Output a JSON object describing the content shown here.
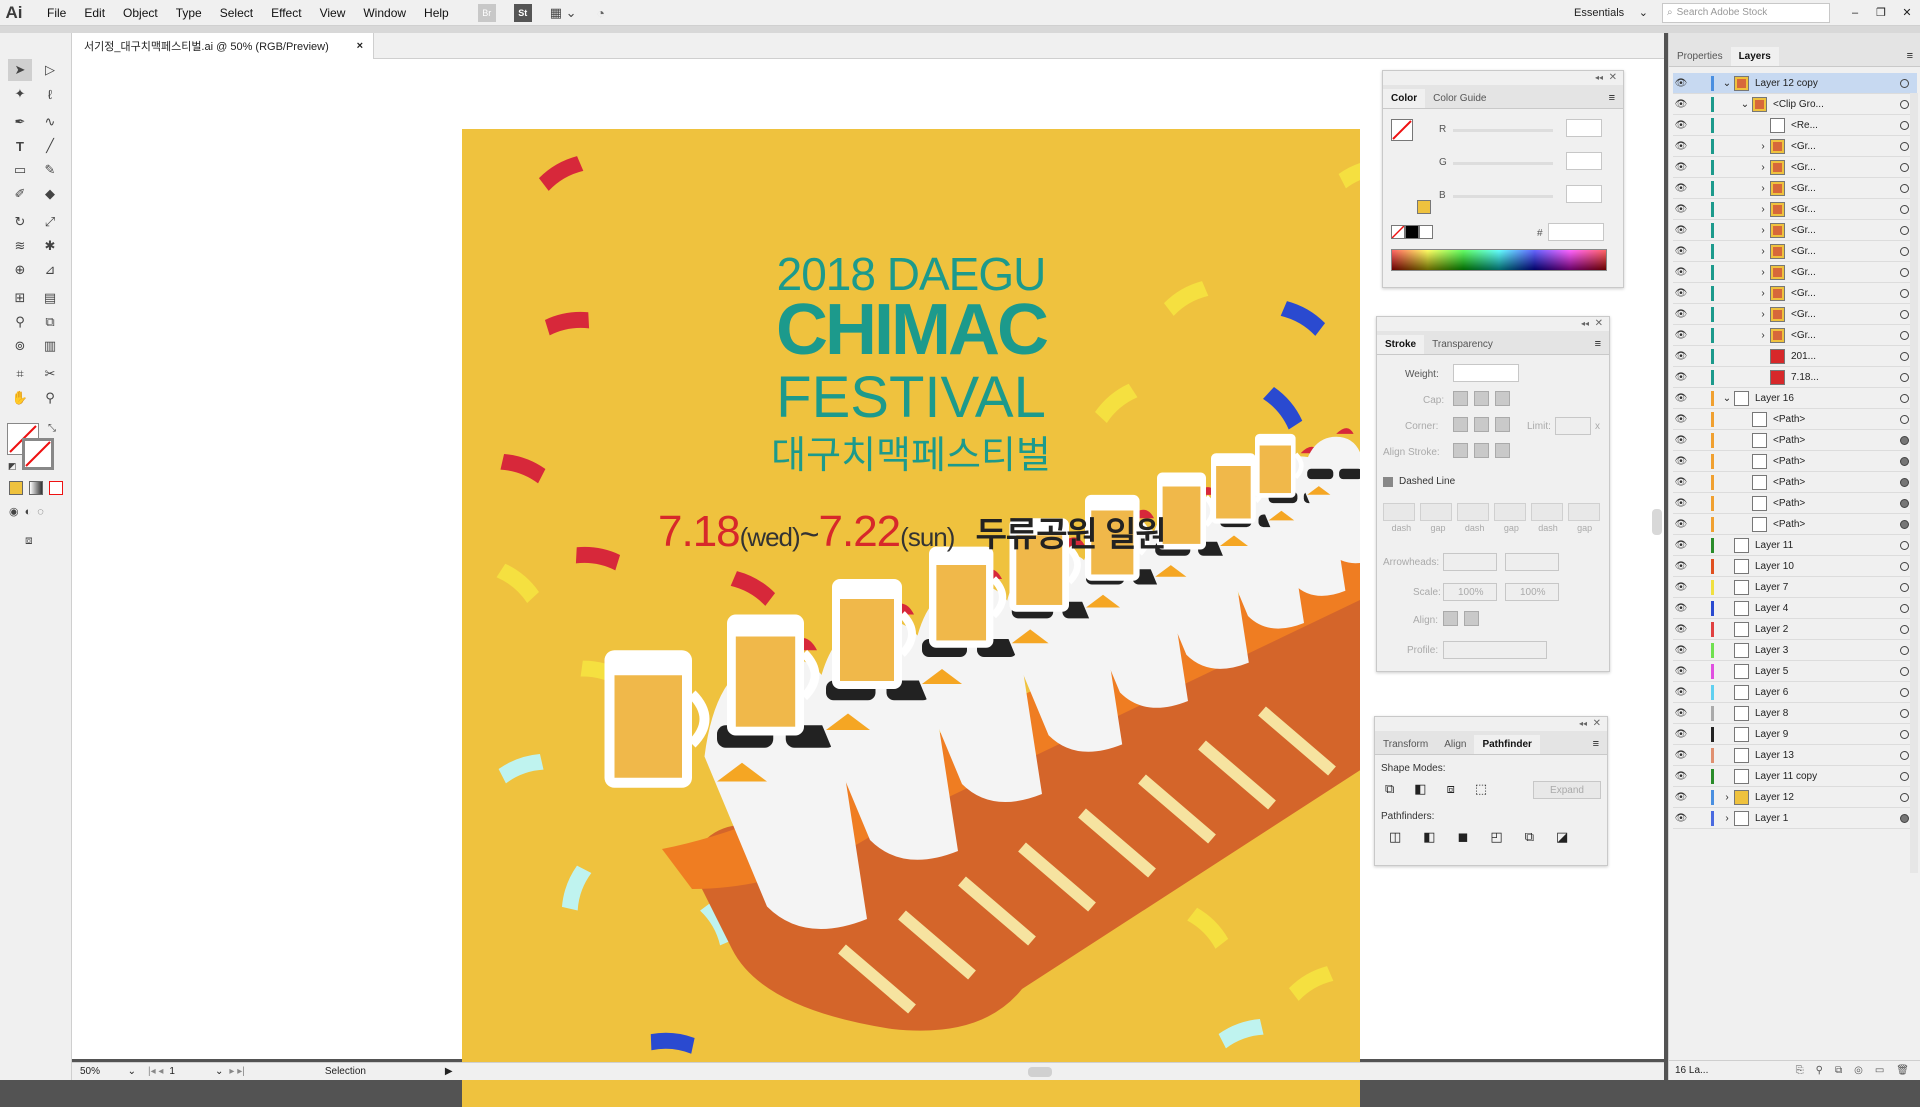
{
  "menubar": {
    "logo": "Ai",
    "items": [
      "File",
      "Edit",
      "Object",
      "Type",
      "Select",
      "Effect",
      "View",
      "Window",
      "Help"
    ],
    "bridge": "Br",
    "stock": "St",
    "workspace": "Essentials",
    "search_placeholder": "Search Adobe Stock"
  },
  "document": {
    "tab_title": "서기정_대구치맥페스티벌.ai @ 50% (RGB/Preview)",
    "close": "×"
  },
  "artwork": {
    "line1": "2018 DAEGU",
    "line2": "CHIMAC",
    "line3": "FESTIVAL",
    "line4": "대구치맥페스티벌",
    "date_start": "7.18",
    "day_start": "(wed)",
    "tilde": "~",
    "date_end": "7.22",
    "day_end": "(sun)",
    "venue": "두류공원 일원",
    "colors": {
      "background": "#efc23e",
      "teal": "#1c9a8c",
      "red": "#d7282a"
    }
  },
  "color_panel": {
    "tabs": [
      "Color",
      "Color Guide"
    ],
    "r": "R",
    "g": "G",
    "b": "B",
    "hash": "#"
  },
  "stroke_panel": {
    "tabs": [
      "Stroke",
      "Transparency"
    ],
    "weight": "Weight:",
    "cap": "Cap:",
    "corner": "Corner:",
    "limit": "Limit:",
    "limit_unit": "x",
    "align_stroke": "Align Stroke:",
    "dashed_line": "Dashed Line",
    "dash_labels": [
      "dash",
      "gap",
      "dash",
      "gap",
      "dash",
      "gap"
    ],
    "arrowheads": "Arrowheads:",
    "scale": "Scale:",
    "scale_a": "100%",
    "scale_b": "100%",
    "align": "Align:",
    "profile": "Profile:"
  },
  "pathfinder_panel": {
    "tabs": [
      "Transform",
      "Align",
      "Pathfinder"
    ],
    "shape_modes": "Shape Modes:",
    "expand": "Expand",
    "pathfinders": "Pathfinders:"
  },
  "layers_panel": {
    "tabs": [
      "Properties",
      "Layers"
    ],
    "footer": "16 La...",
    "rows": [
      {
        "name": "Layer 12 copy",
        "indent": 0,
        "arrow": "⌄",
        "color": "#4a8fe0",
        "sel": true,
        "dot": false
      },
      {
        "name": "<Clip Gro...",
        "indent": 1,
        "arrow": "⌄",
        "color": "#1c9a8c",
        "dot": false
      },
      {
        "name": "<Re...",
        "indent": 2,
        "arrow": "",
        "color": "#1c9a8c",
        "dot": false
      },
      {
        "name": "<Gr...",
        "indent": 2,
        "arrow": "›",
        "color": "#1c9a8c",
        "dot": false
      },
      {
        "name": "<Gr...",
        "indent": 2,
        "arrow": "›",
        "color": "#1c9a8c",
        "dot": false
      },
      {
        "name": "<Gr...",
        "indent": 2,
        "arrow": "›",
        "color": "#1c9a8c",
        "dot": false
      },
      {
        "name": "<Gr...",
        "indent": 2,
        "arrow": "›",
        "color": "#1c9a8c",
        "dot": false
      },
      {
        "name": "<Gr...",
        "indent": 2,
        "arrow": "›",
        "color": "#1c9a8c",
        "dot": false
      },
      {
        "name": "<Gr...",
        "indent": 2,
        "arrow": "›",
        "color": "#1c9a8c",
        "dot": false
      },
      {
        "name": "<Gr...",
        "indent": 2,
        "arrow": "›",
        "color": "#1c9a8c",
        "dot": false
      },
      {
        "name": "<Gr...",
        "indent": 2,
        "arrow": "›",
        "color": "#1c9a8c",
        "dot": false
      },
      {
        "name": "<Gr...",
        "indent": 2,
        "arrow": "›",
        "color": "#1c9a8c",
        "dot": false
      },
      {
        "name": "<Gr...",
        "indent": 2,
        "arrow": "›",
        "color": "#1c9a8c",
        "dot": false
      },
      {
        "name": "201...",
        "indent": 2,
        "arrow": "",
        "color": "#1c9a8c",
        "dot": false
      },
      {
        "name": "7.18...",
        "indent": 2,
        "arrow": "",
        "color": "#1c9a8c",
        "dot": false
      },
      {
        "name": "Layer 16",
        "indent": 0,
        "arrow": "⌄",
        "color": "#f0a030",
        "dot": false
      },
      {
        "name": "<Path>",
        "indent": 1,
        "arrow": "",
        "color": "#f0a030",
        "dot": false
      },
      {
        "name": "<Path>",
        "indent": 1,
        "arrow": "",
        "color": "#f0a030",
        "dot": true
      },
      {
        "name": "<Path>",
        "indent": 1,
        "arrow": "",
        "color": "#f0a030",
        "dot": true
      },
      {
        "name": "<Path>",
        "indent": 1,
        "arrow": "",
        "color": "#f0a030",
        "dot": true
      },
      {
        "name": "<Path>",
        "indent": 1,
        "arrow": "",
        "color": "#f0a030",
        "dot": true
      },
      {
        "name": "<Path>",
        "indent": 1,
        "arrow": "",
        "color": "#f0a030",
        "dot": true
      },
      {
        "name": "Layer 11",
        "indent": 0,
        "arrow": "",
        "color": "#2a8c2a",
        "dot": false
      },
      {
        "name": "Layer 10",
        "indent": 0,
        "arrow": "",
        "color": "#e05020",
        "dot": false
      },
      {
        "name": "Layer 7",
        "indent": 0,
        "arrow": "",
        "color": "#f0e040",
        "dot": false
      },
      {
        "name": "Layer 4",
        "indent": 0,
        "arrow": "",
        "color": "#2a4ad0",
        "dot": false
      },
      {
        "name": "Layer 2",
        "indent": 0,
        "arrow": "",
        "color": "#e04040",
        "dot": false
      },
      {
        "name": "Layer 3",
        "indent": 0,
        "arrow": "",
        "color": "#70e050",
        "dot": false
      },
      {
        "name": "Layer 5",
        "indent": 0,
        "arrow": "",
        "color": "#e050e0",
        "dot": false
      },
      {
        "name": "Layer 6",
        "indent": 0,
        "arrow": "",
        "color": "#60d0f0",
        "dot": false
      },
      {
        "name": "Layer 8",
        "indent": 0,
        "arrow": "",
        "color": "#aaaaaa",
        "dot": false
      },
      {
        "name": "Layer 9",
        "indent": 0,
        "arrow": "",
        "color": "#222222",
        "dot": false
      },
      {
        "name": "Layer 13",
        "indent": 0,
        "arrow": "",
        "color": "#e09070",
        "dot": false
      },
      {
        "name": "Layer 11 copy",
        "indent": 0,
        "arrow": "",
        "color": "#2a8c2a",
        "dot": false
      },
      {
        "name": "Layer 12",
        "indent": 0,
        "arrow": "›",
        "color": "#4a8fe0",
        "dot": false
      },
      {
        "name": "Layer 1",
        "indent": 0,
        "arrow": "›",
        "color": "#4a6ae0",
        "dot": true
      }
    ]
  },
  "statusbar": {
    "zoom": "50%",
    "page": "1",
    "tool": "Selection"
  }
}
